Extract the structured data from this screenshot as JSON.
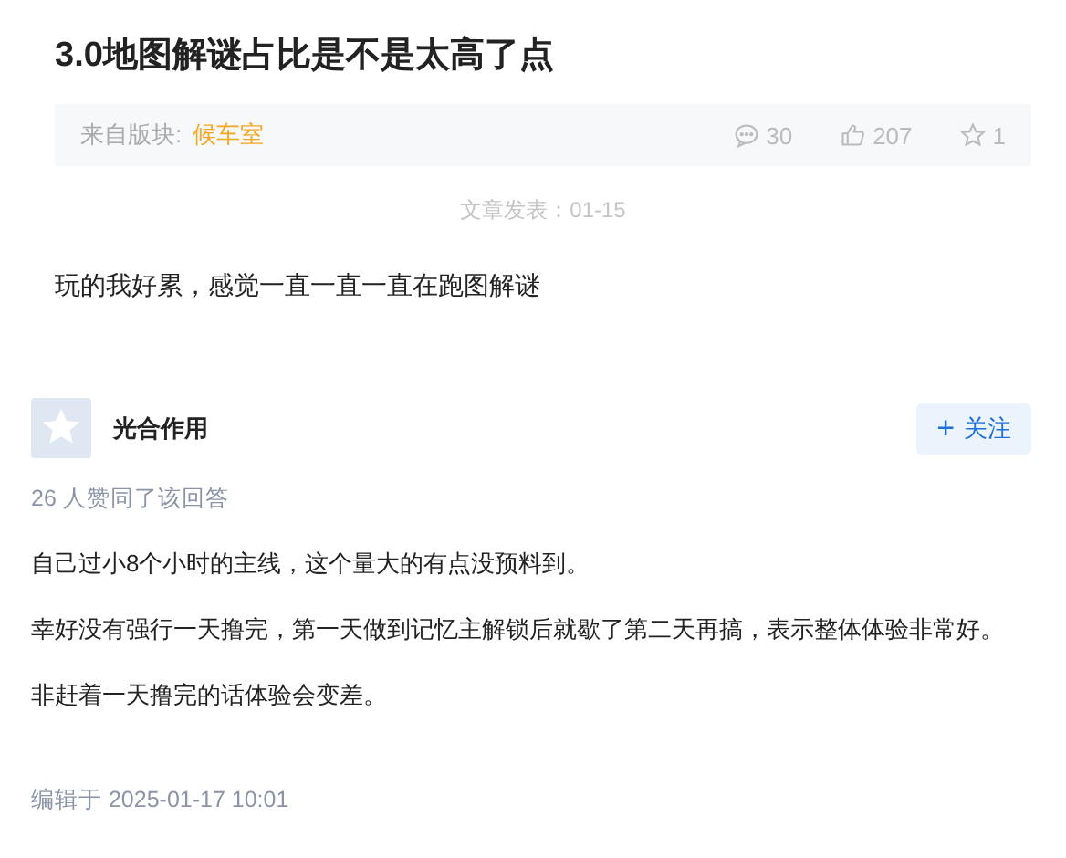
{
  "post": {
    "title": "3.0地图解谜占比是不是太高了点",
    "board_label": "来自版块:",
    "board": "候车室",
    "stats": [
      {
        "kind": "comments",
        "value": "30"
      },
      {
        "kind": "likes",
        "value": "207"
      },
      {
        "kind": "favorites",
        "value": "1"
      }
    ],
    "published": "文章发表：01-15",
    "body": "玩的我好累，感觉一直一直一直在跑图解谜"
  },
  "answer": {
    "author": "光合作用",
    "follow_icon": "+",
    "follow_label": "关注",
    "agree": "26 人赞同了该回答",
    "paragraphs": [
      "自己过小8个小时的主线，这个量大的有点没预料到。",
      "幸好没有强行一天撸完，第一天做到记忆主解锁后就歇了第二天再搞，表示整体体验非常好。",
      "非赶着一天撸完的话体验会变差。"
    ],
    "edited": "编辑于 2025-01-17 10:01"
  }
}
